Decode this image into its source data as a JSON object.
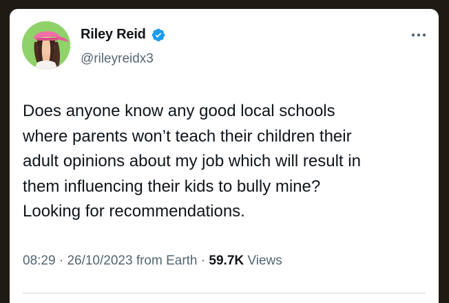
{
  "tweet": {
    "author": {
      "display_name": "Riley Reid",
      "handle": "@rileyreidx3",
      "verified": true,
      "verified_icon": "verified-badge-icon",
      "verified_color": "#1d9bf0"
    },
    "more_icon": "more-horizontal-icon",
    "text_lines": [
      "Does anyone know any good local schools",
      "where parents won’t teach their children their",
      "adult opinions about my job which will result in",
      "them influencing their kids to bully mine?",
      "Looking for recommendations."
    ],
    "meta": {
      "time": "08:29",
      "separator": "·",
      "date": "26/10/2023",
      "source": "from Earth",
      "views_count": "59.7K",
      "views_label": "Views"
    }
  },
  "colors": {
    "background": "#1f1a12",
    "card": "#ffffff",
    "primary_text": "#0f1419",
    "secondary_text": "#536471",
    "accent": "#1d9bf0"
  }
}
